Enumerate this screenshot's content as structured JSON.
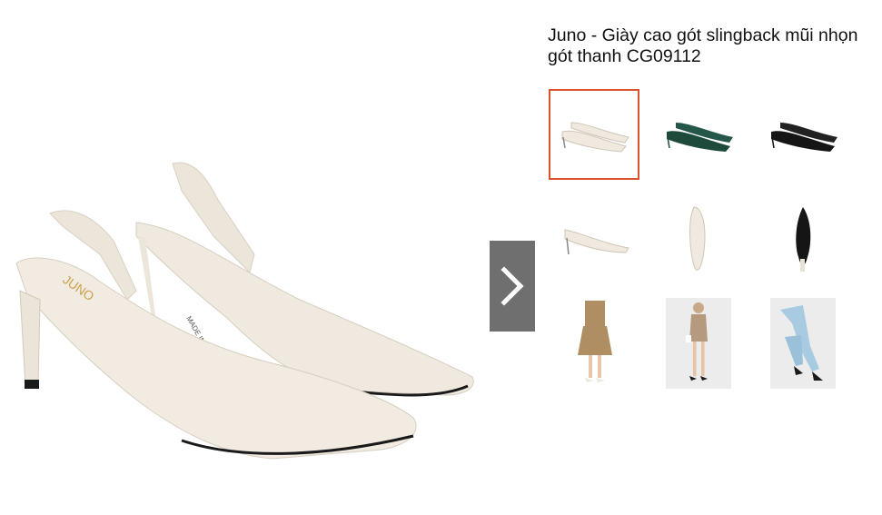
{
  "product": {
    "title": "Juno - Giày cao gót slingback mũi nhọn gót thanh CG09112",
    "insole_print": "JUNO",
    "sole_print": "MADE IN VIETNAM"
  },
  "gallery": {
    "selected_index": 0,
    "next_icon": "chevron-right-icon",
    "thumbnails": [
      {
        "name": "thumb-cream-pair",
        "color": "#efe9df",
        "kind": "shoe-pair"
      },
      {
        "name": "thumb-green-pair",
        "color": "#1e4a3c",
        "kind": "shoe-pair"
      },
      {
        "name": "thumb-black-pair",
        "color": "#151515",
        "kind": "shoe-pair"
      },
      {
        "name": "thumb-side-view",
        "color": "#efe9df",
        "kind": "shoe-side"
      },
      {
        "name": "thumb-top-view",
        "color": "#efe9df",
        "kind": "shoe-top"
      },
      {
        "name": "thumb-sole-view",
        "color": "#151515",
        "kind": "shoe-sole"
      },
      {
        "name": "thumb-model-skirt",
        "color": "#b08e63",
        "kind": "model-photo"
      },
      {
        "name": "thumb-model-dress",
        "color": "#b59a80",
        "kind": "model-photo"
      },
      {
        "name": "thumb-model-jeans",
        "color": "#a9cbe2",
        "kind": "model-photo"
      }
    ]
  },
  "colors": {
    "selected_border": "#d9532c",
    "nav_button": "#6f6f6f"
  }
}
